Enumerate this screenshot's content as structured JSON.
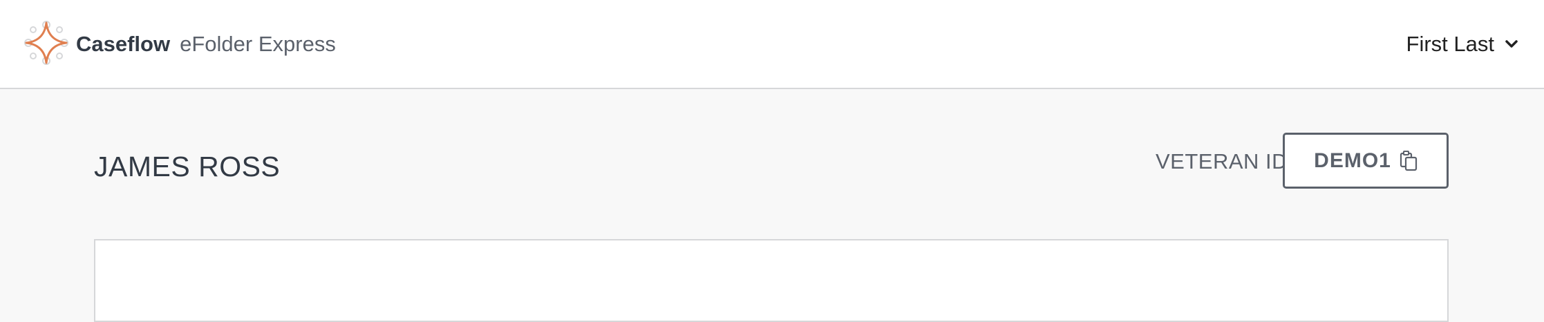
{
  "header": {
    "app_name": "Caseflow",
    "product_name": "eFolder Express",
    "logo_icon": "caseflow-logo-icon",
    "brand_color": "#e07f50"
  },
  "user_menu": {
    "name": "First Last",
    "icon": "chevron-down-icon"
  },
  "veteran": {
    "name": "JAMES ROSS",
    "id_label": "VETERAN ID",
    "id_value": "DEMO1",
    "copy_icon": "clipboard-icon"
  }
}
